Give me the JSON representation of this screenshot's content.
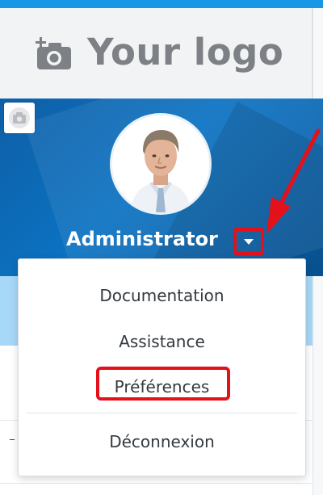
{
  "header": {
    "logo_text": "Your logo",
    "logo_icon": "add-photo-icon",
    "accent_color": "#1797e6"
  },
  "profile": {
    "cover_camera_icon": "camera-icon",
    "avatar": "user-avatar-photo",
    "user_name": "Administrator",
    "dropdown_icon": "caret-down-icon",
    "banner_color": "#0b6cbd"
  },
  "user_menu": {
    "items": [
      {
        "label": "Documentation"
      },
      {
        "label": "Assistance"
      },
      {
        "label": "Préférences"
      },
      {
        "label": "Déconnexion"
      }
    ]
  },
  "annotations": {
    "highlight_color": "#e4101a"
  }
}
